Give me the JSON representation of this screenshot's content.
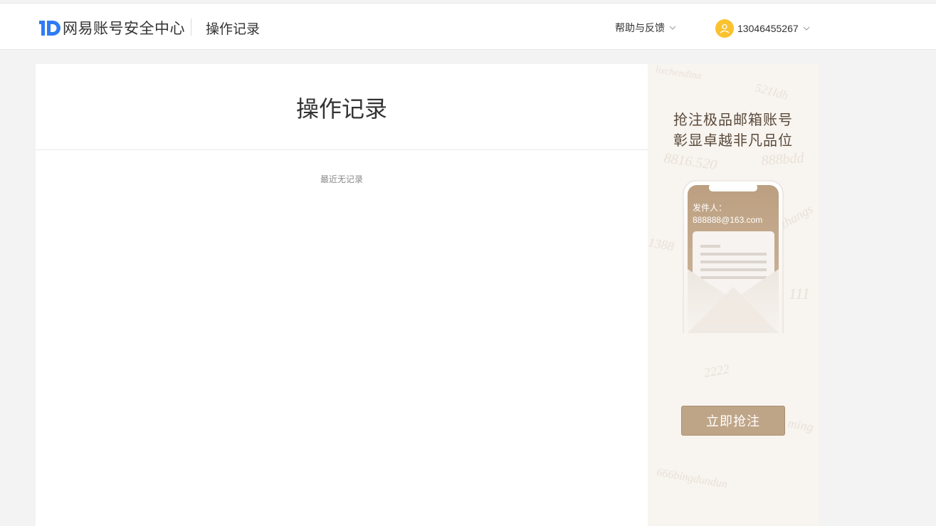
{
  "header": {
    "brand": "网易账号安全中心",
    "page_name": "操作记录",
    "help_label": "帮助与反馈",
    "user_phone": "13046455267"
  },
  "main": {
    "title": "操作记录",
    "empty_text": "最近无记录"
  },
  "ad": {
    "headline_1": "抢注极品邮箱账号",
    "headline_2": "彰显卓越非凡品位",
    "sender_label": "发件人：",
    "sender_email": "888888@163.com",
    "cta_label": "立即抢注"
  },
  "colors": {
    "brand_blue": "#2f7bf5",
    "avatar_yellow": "#f9c22e",
    "ad_gold": "#bfa588",
    "page_bg": "#f3f3f3"
  },
  "icons": [
    "logo-id-icon",
    "chevron-down-icon",
    "user-avatar-icon"
  ]
}
